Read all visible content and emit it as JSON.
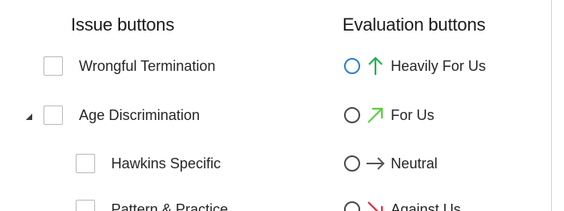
{
  "headers": {
    "issues": "Issue buttons",
    "evaluations": "Evaluation buttons"
  },
  "issues": [
    {
      "label": "Wrongful Termination",
      "checked": false,
      "level": 0,
      "expander": null
    },
    {
      "label": "Age Discrimination",
      "checked": false,
      "level": 0,
      "expander": "expanded"
    },
    {
      "label": "Hawkins Specific",
      "checked": false,
      "level": 1,
      "expander": null
    },
    {
      "label": "Pattern & Practice",
      "checked": false,
      "level": 1,
      "expander": null
    }
  ],
  "evaluations": [
    {
      "label": "Heavily For Us",
      "arrow_icon": "arrow-up-icon",
      "arrow_color": "#22b14c",
      "focused": true
    },
    {
      "label": "For Us",
      "arrow_icon": "arrow-up-right-icon",
      "arrow_color": "#5ccf3c",
      "focused": false
    },
    {
      "label": "Neutral",
      "arrow_icon": "arrow-right-icon",
      "arrow_color": "#555555",
      "focused": false
    },
    {
      "label": "Against Us",
      "arrow_icon": "arrow-down-right-icon",
      "arrow_color": "#e8283c",
      "focused": false
    }
  ],
  "colors": {
    "radio_focus": "#2b7fd6",
    "checkbox_border": "#b9b9b9"
  }
}
